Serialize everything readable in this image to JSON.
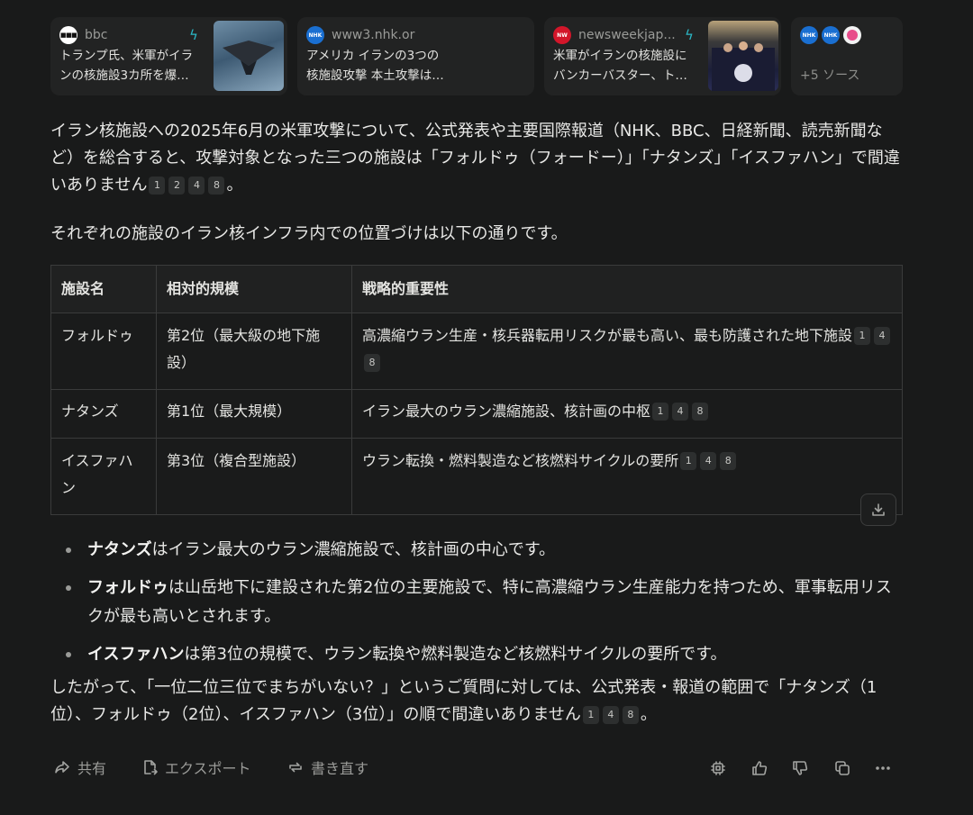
{
  "sources": [
    {
      "site": "bbc",
      "title_line1": "トランプ氏、米軍がイラ",
      "title_line2": "ンの核施設3カ所を爆…",
      "icon": "bbc-favicon"
    },
    {
      "site": "www3.nhk.or",
      "title_line1": "アメリカ イランの3つの",
      "title_line2": "核施設攻撃 本土攻撃は…",
      "icon": "nhk-favicon"
    },
    {
      "site": "newsweekjap...",
      "title_line1": "米軍がイランの核施設に",
      "title_line2": "バンカーバスター、ト…",
      "icon": "newsweek-favicon"
    },
    {
      "more_label": "+5 ソース"
    }
  ],
  "intro": {
    "text": "イラン核施設への2025年6月の米軍攻撃について、公式発表や主要国際報道（NHK、BBC、日経新聞、読売新聞など）を総合すると、攻撃対象となった三つの施設は「フォルドゥ（フォードー）」「ナタンズ」「イスファハン」で間違いありません",
    "citations": [
      "1",
      "2",
      "4",
      "8"
    ],
    "end": "。"
  },
  "lead": "それぞれの施設のイラン核インフラ内での位置づけは以下の通りです。",
  "table": {
    "headers": [
      "施設名",
      "相対的規模",
      "戦略的重要性"
    ],
    "rows": [
      {
        "name": "フォルドゥ",
        "scale": "第2位（最大級の地下施設）",
        "importance": "高濃縮ウラン生産・核兵器転用リスクが最も高い、最も防護された地下施設",
        "citations": [
          "1",
          "4",
          "8"
        ]
      },
      {
        "name": "ナタンズ",
        "scale": "第1位（最大規模）",
        "importance": "イラン最大のウラン濃縮施設、核計画の中枢",
        "citations": [
          "1",
          "4",
          "8"
        ]
      },
      {
        "name": "イスファハン",
        "scale": "第3位（複合型施設）",
        "importance": "ウラン転換・燃料製造など核燃料サイクルの要所",
        "citations": [
          "1",
          "4",
          "8"
        ]
      }
    ]
  },
  "bullets": [
    {
      "bold": "ナタンズ",
      "text": "はイラン最大のウラン濃縮施設で、核計画の中心です。"
    },
    {
      "bold": "フォルドゥ",
      "text": "は山岳地下に建設された第2位の主要施設で、特に高濃縮ウラン生産能力を持つため、軍事転用リスクが最も高いとされます。"
    },
    {
      "bold": "イスファハン",
      "text": "は第3位の規模で、ウラン転換や燃料製造など核燃料サイクルの要所です。"
    }
  ],
  "conclusion": {
    "text": "したがって、「一位二位三位でまちがいない？」というご質問に対しては、公式発表・報道の範囲で「ナタンズ（1位）、フォルドゥ（2位）、イスファハン（3位）」の順で間違いありません",
    "citations": [
      "1",
      "4",
      "8"
    ],
    "end": "。"
  },
  "actions": {
    "share": "共有",
    "export": "エクスポート",
    "rewrite": "書き直す"
  },
  "colors": {
    "background": "#191a1a",
    "card": "#222323",
    "accent": "#2bb8c6"
  }
}
